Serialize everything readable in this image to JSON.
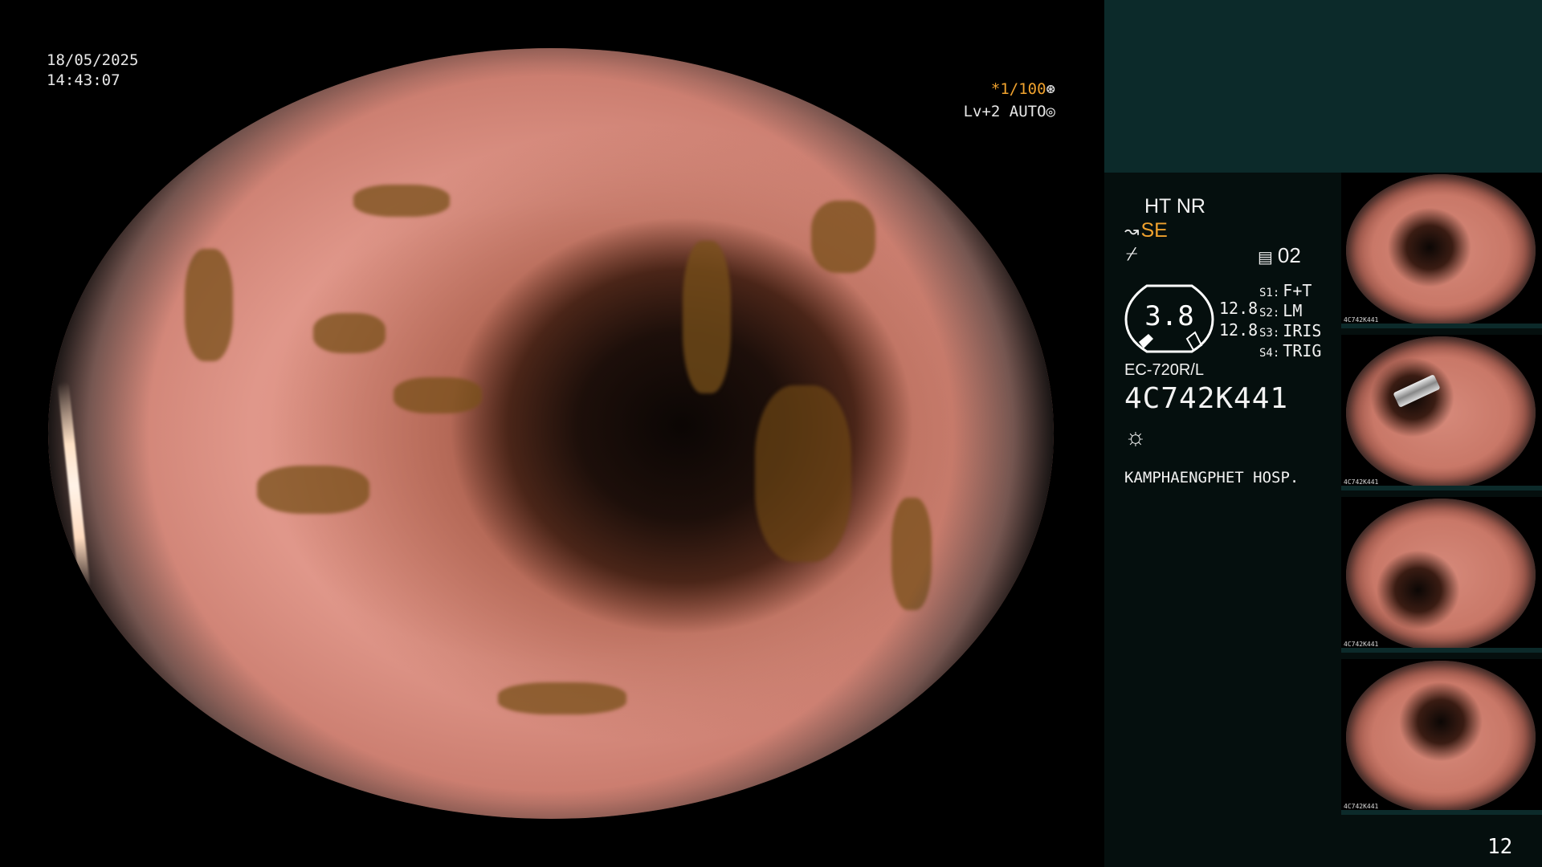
{
  "overlay": {
    "date": "18/05/2025",
    "time": "14:43:07",
    "shutter": "*1/100",
    "shutter_icon": "⊛",
    "level": "Lv+2 AUTO",
    "level_icon": "◎"
  },
  "panel": {
    "ht_nr": "HT NR",
    "se_icon": "↝",
    "se": "SE",
    "sub_icon": "⌿",
    "memory_icon": "▤",
    "memory": "02",
    "gauge_value": "3.8",
    "value_a": "12.8",
    "value_b": "12.8",
    "switches": [
      {
        "key": "S1:",
        "value": "F+T"
      },
      {
        "key": "S2:",
        "value": "LM"
      },
      {
        "key": "S3:",
        "value": "IRIS"
      },
      {
        "key": "S4:",
        "value": "TRIG"
      }
    ],
    "scope_model": "EC-720R/L",
    "scope_serial": "4C742K441",
    "light_icon": "☼",
    "hospital": "KAMPHAENGPHET HOSP."
  },
  "thumbnails": [
    {
      "serial": "4C742K441"
    },
    {
      "serial": "4C742K441"
    },
    {
      "serial": "4C742K441"
    },
    {
      "serial": "4C742K441"
    }
  ],
  "page_number": "12",
  "colors": {
    "accent": "#f0a22e",
    "panel_top": "#0c2a2a",
    "panel": "#050f0e"
  }
}
